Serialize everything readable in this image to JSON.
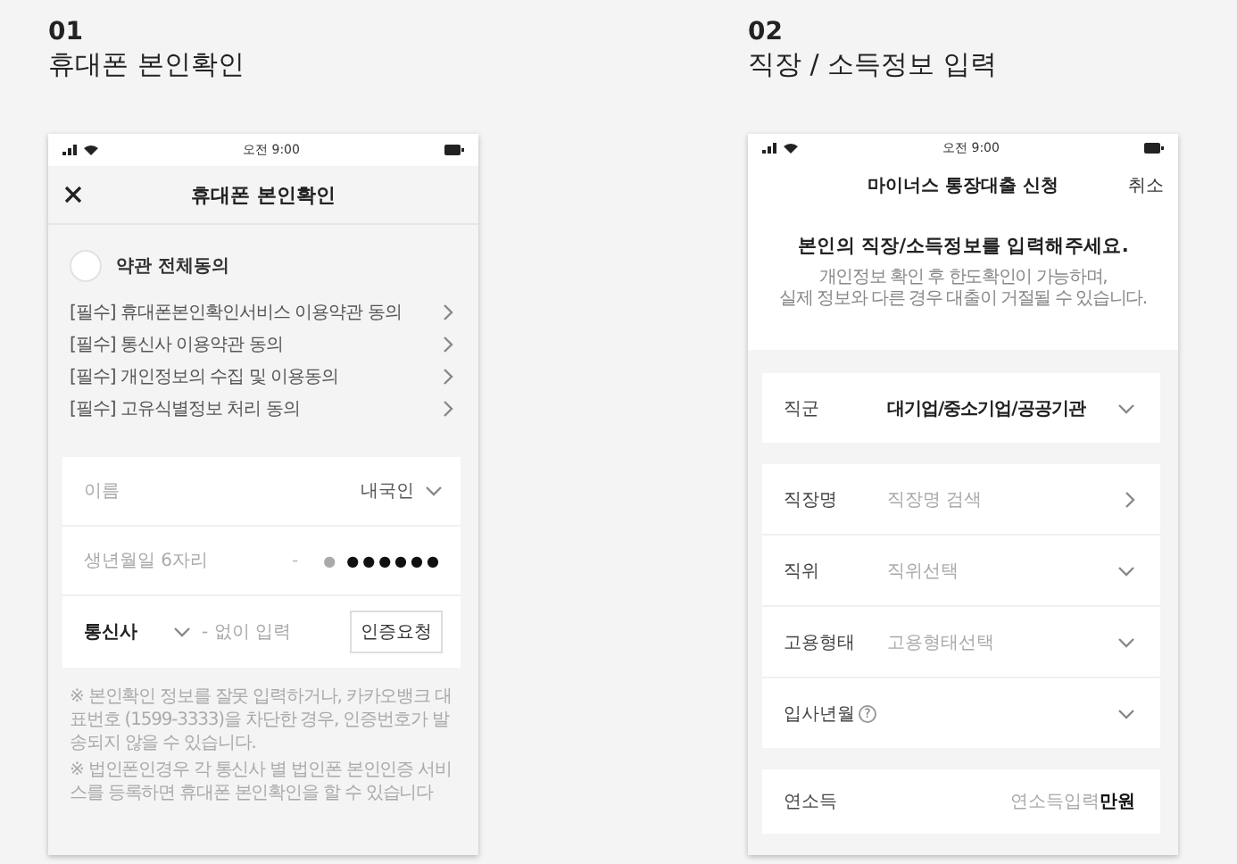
{
  "steps": [
    {
      "number": "01",
      "title": "휴대폰 본인확인"
    },
    {
      "number": "02",
      "title": "직장 / 소득정보 입력"
    }
  ],
  "identity_screen": {
    "status_time": "오전 9:00",
    "title": "휴대폰 본인확인",
    "agree_all": {
      "label": "약관 전체동의",
      "checked": false
    },
    "terms": [
      {
        "label": "[필수] 휴대폰본인확인서비스 이용약관 동의"
      },
      {
        "label": "[필수] 통신사 이용약관 동의"
      },
      {
        "label": "[필수] 개인정보의 수집 및 이용동의"
      },
      {
        "label": "[필수] 고유식별정보 처리 동의"
      }
    ],
    "name_placeholder": "이름",
    "nationality": "내국인",
    "birth_placeholder": "생년월일 6자리",
    "dash": "-",
    "gender_digit": "●",
    "masked_digits": "●●●●●●",
    "carrier": "통신사",
    "phone_placeholder": "- 없이 입력",
    "request_button": "인증요청",
    "notes": [
      "※ 본인확인 정보를 잘못 입력하거나, 카카오뱅크 대표번호 (1599-3333)을 차단한 경우, 인증번호가 발송되지 않을 수 있습니다.",
      "※ 법인폰인경우 각 통신사 별 법인폰 본인인증 서비스를 등록하면 휴대폰 본인확인을 할 수 있습니다"
    ]
  },
  "job_screen": {
    "status_time": "오전 9:00",
    "title": "마이너스 통장대출 신청",
    "cancel": "취소",
    "heading": "본인의 직장/소득정보를 입력해주세요.",
    "subtext": [
      "개인정보 확인 후 한도확인이 가능하며,",
      "실제 정보와 다른 경우 대출이 거절될 수 있습니다."
    ],
    "groups": [
      {
        "fields": [
          {
            "kind": "select",
            "label": "직군",
            "value": "대기업/중소기업/공공기관"
          }
        ]
      },
      {
        "fields": [
          {
            "kind": "link",
            "label": "직장명",
            "placeholder": "직장명 검색"
          },
          {
            "kind": "select",
            "label": "직위",
            "placeholder": "직위선택"
          },
          {
            "kind": "select",
            "label": "고용형태",
            "placeholder": "고용형태선택"
          },
          {
            "kind": "select",
            "label": "입사년월",
            "help": "?"
          }
        ]
      },
      {
        "fields": [
          {
            "kind": "amount",
            "label": "연소득",
            "placeholder": "연소득입력",
            "unit": "만원"
          }
        ]
      }
    ]
  }
}
